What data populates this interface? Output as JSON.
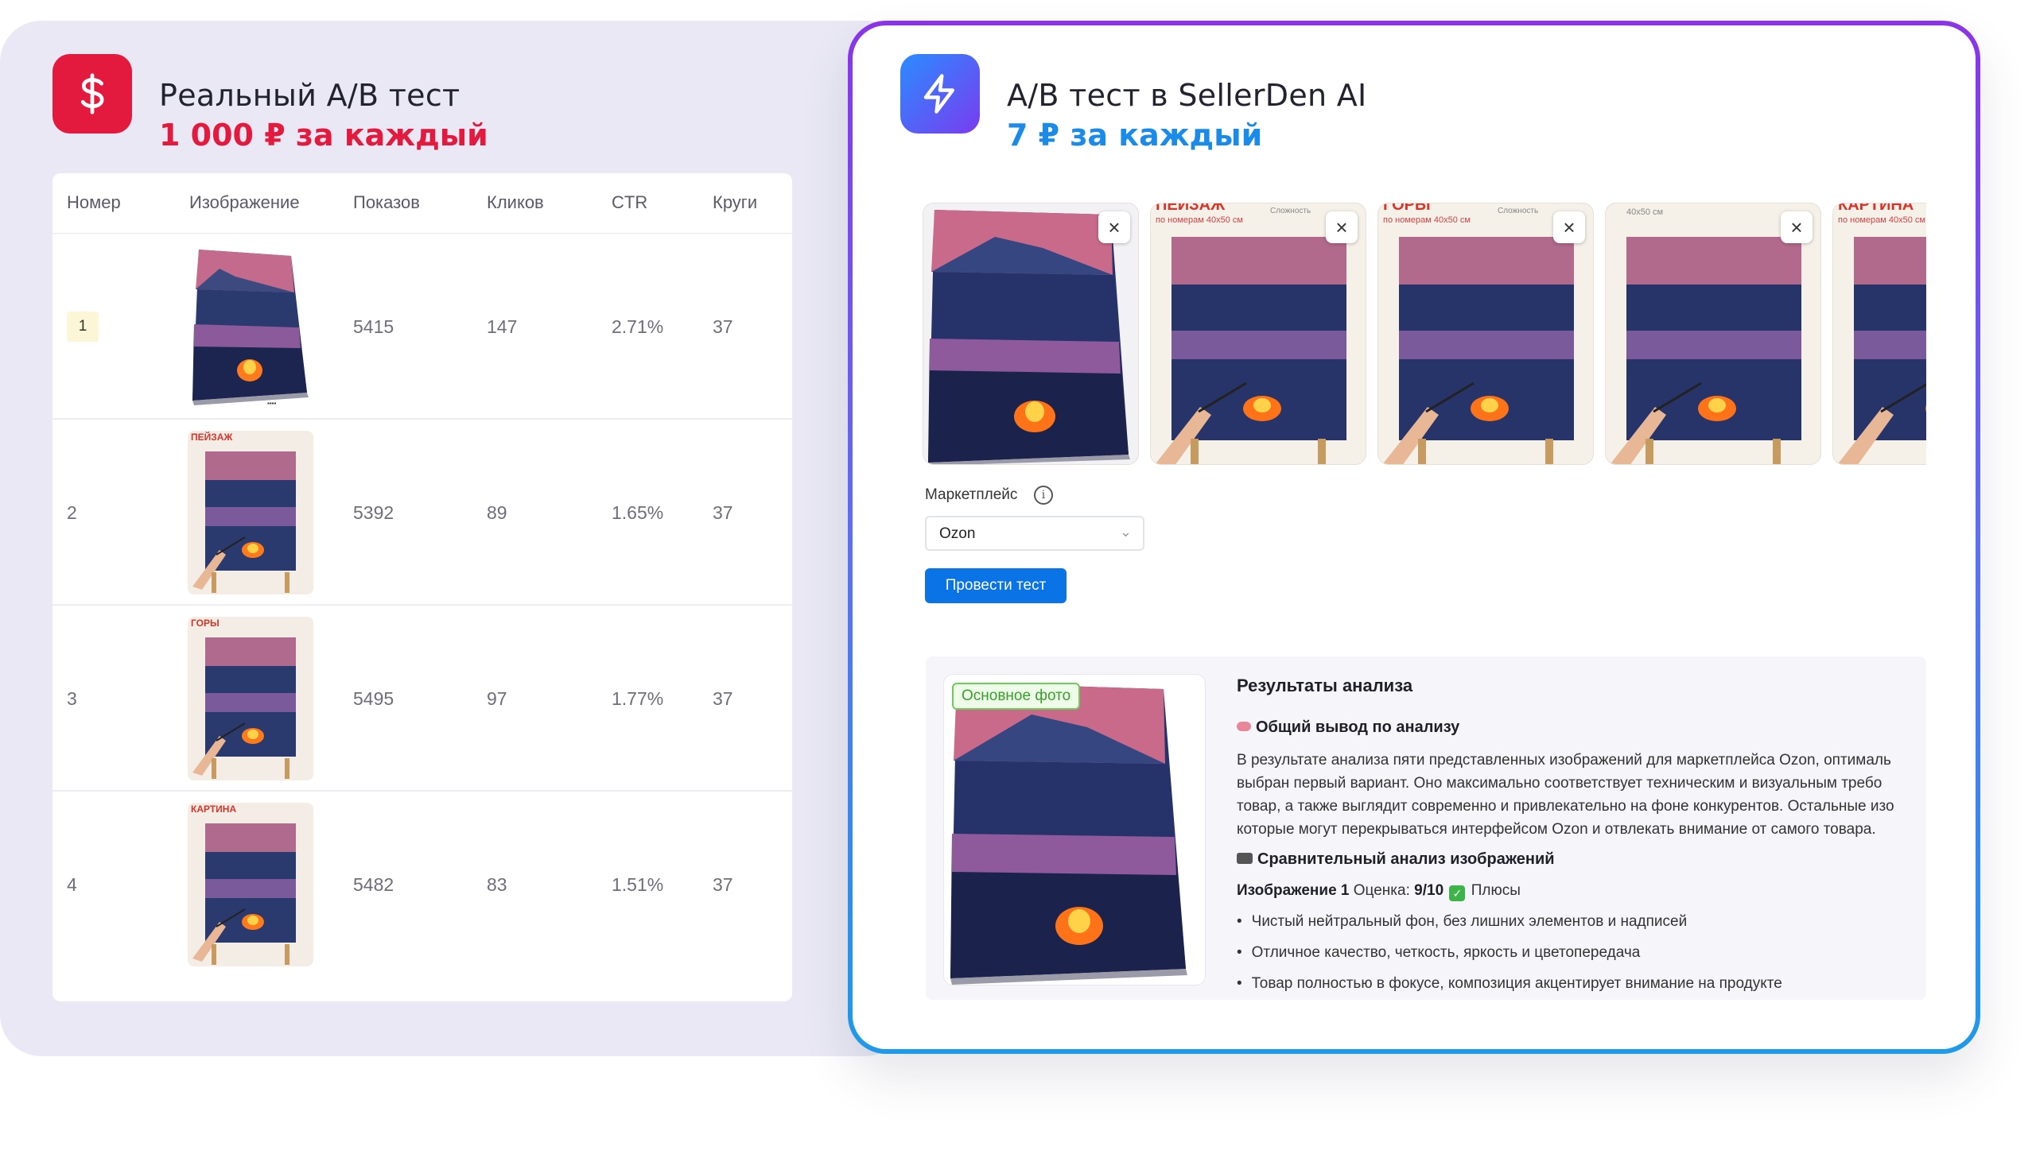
{
  "left": {
    "title": "Реальный A/B тест",
    "price": "1 000 ₽ за каждый",
    "icon": "dollar-icon",
    "accent": "#e3193d",
    "columns": [
      "Номер",
      "Изображение",
      "Показов",
      "Кликов",
      "CTR",
      "Круги"
    ],
    "rows": [
      {
        "num": "1",
        "shows": "5415",
        "clicks": "147",
        "ctr": "2.71%",
        "rounds": "37"
      },
      {
        "num": "2",
        "shows": "5392",
        "clicks": "89",
        "ctr": "1.65%",
        "rounds": "37",
        "label": "ПЕЙЗАЖ"
      },
      {
        "num": "3",
        "shows": "5495",
        "clicks": "97",
        "ctr": "1.77%",
        "rounds": "37",
        "label": "ГОРЫ"
      },
      {
        "num": "4",
        "shows": "5482",
        "clicks": "83",
        "ctr": "1.51%",
        "rounds": "37",
        "label": "КАРТИНА"
      }
    ]
  },
  "right": {
    "title": "A/B тест в SellerDen AI",
    "price": "7 ₽ за каждый",
    "icon": "lightning-icon",
    "accent": "#1a8be8",
    "strip_labels": [
      "ПЕЙЗАЖ",
      "ГОРЫ",
      "",
      "КАРТИНА"
    ],
    "strip_sub": "по номерам 40x50 см",
    "strip_misc": [
      "Сложность",
      "Сложность",
      "40x50 см",
      ""
    ],
    "marketplace_label": "Маркетплейс",
    "marketplace_value": "Ozon",
    "run_button": "Провести тест",
    "results": {
      "photo_tag": "Основное фото",
      "title": "Результаты анализа",
      "summary_heading": "Общий вывод по анализу",
      "summary_lines": [
        "В результате анализа пяти представленных изображений для маркетплейса Ozon, оптималь",
        "выбран первый вариант. Оно максимально соответствует техническим и визуальным требо",
        "товар, а также выглядит современно и привлекательно на фоне конкурентов. Остальные изо",
        "которые могут перекрываться интерфейсом Ozon и отвлекать внимание от самого товара."
      ],
      "compare_heading": "Сравнительный анализ изображений",
      "image_label": "Изображение 1",
      "score_label": "Оценка:",
      "score": "9/10",
      "pros_label": "Плюсы",
      "bullets": [
        "Чистый нейтральный фон, без лишних элементов и надписей",
        "Отличное качество, четкость, яркость и цветопередача",
        "Товар полностью в фокусе, композиция акцентирует внимание на продукте"
      ]
    }
  }
}
